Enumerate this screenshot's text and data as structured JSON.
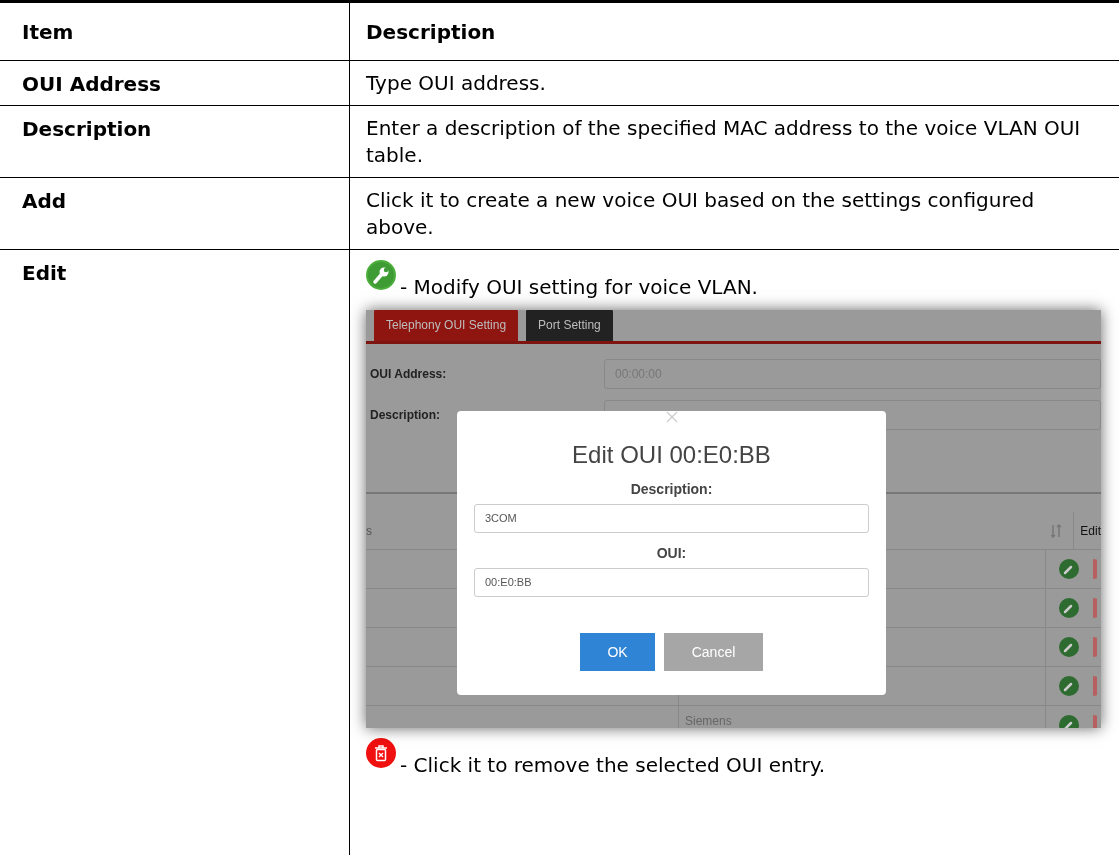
{
  "table": {
    "columns": [
      "Item",
      "Description"
    ],
    "rows": [
      {
        "item": "OUI Address",
        "kind": "text",
        "description": "Type OUI address."
      },
      {
        "item": "Description",
        "kind": "text",
        "description": "Enter a description of the specified MAC address to the voice VLAN OUI table."
      },
      {
        "item": "Add",
        "kind": "text",
        "description": "Click it to create a new voice OUI based on the settings configured above."
      },
      {
        "item": "Edit",
        "kind": "icons",
        "entries": [
          {
            "kind": "edit",
            "text": "- Modify OUI setting for voice VLAN."
          },
          {
            "kind": "screenshot"
          },
          {
            "kind": "delete",
            "text": "- Click it to remove the selected OUI entry."
          }
        ]
      }
    ]
  },
  "screenshot": {
    "tabs": [
      {
        "label": "Telephony OUI Setting",
        "selected": true
      },
      {
        "label": "Port Setting",
        "selected": false
      }
    ],
    "form": [
      {
        "label": "OUI Address:",
        "placeholder": "00:00:00"
      },
      {
        "label": "Description:"
      }
    ],
    "list": {
      "columns": [
        "s",
        "Edit"
      ],
      "rows": [
        {},
        {},
        {},
        {},
        {
          "column_2": "Siemens"
        }
      ]
    },
    "dialog": {
      "title": "Edit OUI 00:E0:BB",
      "fields": [
        {
          "label": "Description:",
          "value": "3COM"
        },
        {
          "label": "OUI:",
          "value": "00:E0:BB"
        }
      ],
      "buttons": [
        {
          "label": "OK",
          "kind": "primary"
        },
        {
          "label": "Cancel",
          "kind": "secondary"
        }
      ]
    }
  }
}
